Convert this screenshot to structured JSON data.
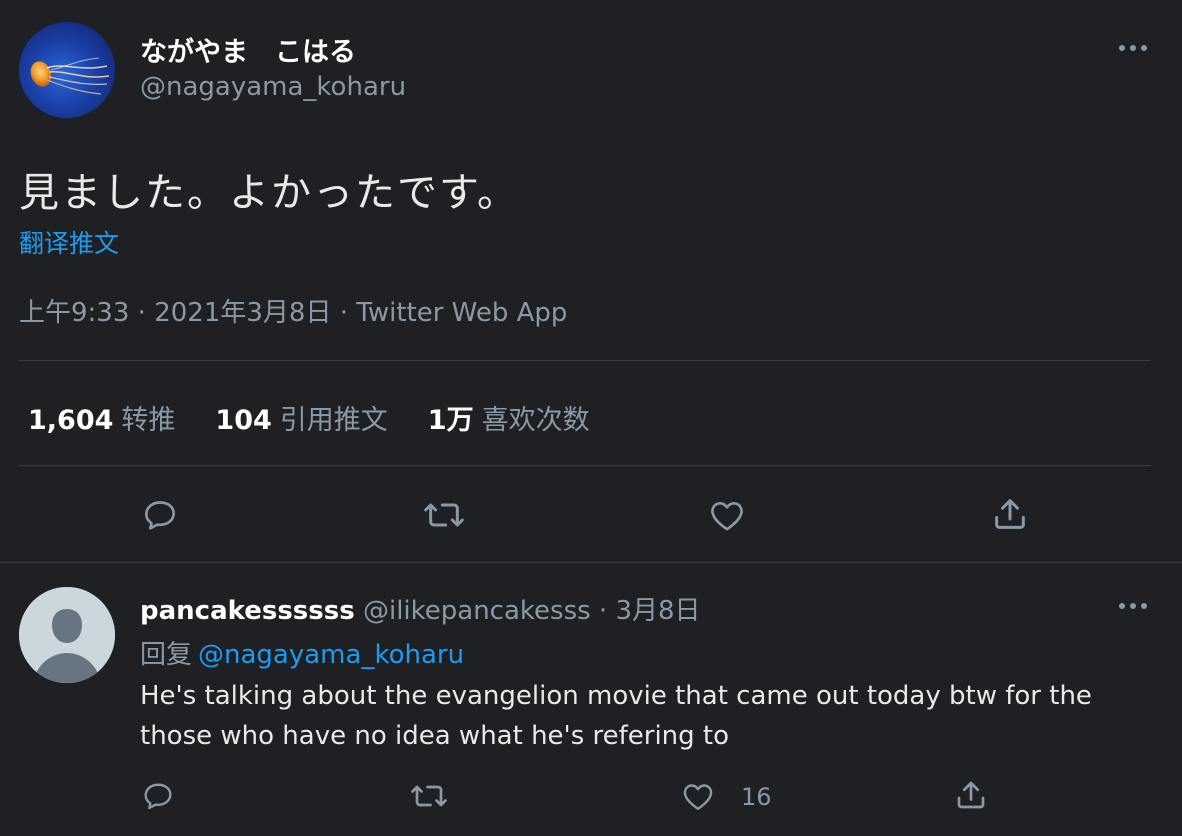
{
  "tweet": {
    "author": {
      "display_name": "ながやま　こはる",
      "handle": "@nagayama_koharu"
    },
    "text": "見ました。よかったです。",
    "translate_label": "翻译推文",
    "meta": {
      "time": "上午9:33",
      "date": "2021年3月8日",
      "source": "Twitter Web App",
      "separator": " · "
    },
    "stats": {
      "retweets": {
        "count": "1,604",
        "label": "转推"
      },
      "quotes": {
        "count": "104",
        "label": "引用推文"
      },
      "likes": {
        "count": "1万",
        "label": "喜欢次数"
      }
    },
    "actions": [
      "reply-icon",
      "retweet-icon",
      "like-icon",
      "share-icon"
    ]
  },
  "reply": {
    "author": {
      "display_name": "pancakessssss",
      "handle": "@ilikepancakesss",
      "date": "3月8日",
      "separator": " · "
    },
    "replying_to_label": "回复",
    "replying_to_handle": "@nagayama_koharu",
    "text": "He's talking about the evangelion movie that came out today btw for the those who have no idea what he's refering to",
    "like_count": "16",
    "actions": [
      "reply-icon",
      "retweet-icon",
      "like-icon",
      "share-icon"
    ]
  },
  "colors": {
    "background": "#1f2023",
    "primary_text": "#e7e9ea",
    "secondary_text": "#8b98a5",
    "link": "#1d9bf0",
    "divider": "#3a3e43"
  }
}
